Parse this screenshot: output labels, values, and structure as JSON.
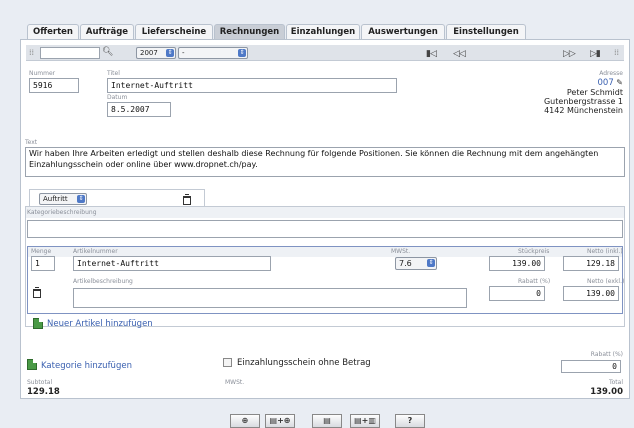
{
  "tabs": [
    {
      "label": "Offerten",
      "active": false
    },
    {
      "label": "Aufträge",
      "active": false
    },
    {
      "label": "Lieferscheine",
      "active": false
    },
    {
      "label": "Rechnungen",
      "active": true
    },
    {
      "label": "Einzahlungen",
      "active": false
    },
    {
      "label": "Auswertungen",
      "active": false
    },
    {
      "label": "Einstellungen",
      "active": false
    }
  ],
  "nav": {
    "year": "2007",
    "filter": "-",
    "first": "▮◁",
    "prev": "◁◁",
    "next": "▷▷",
    "last": "▷▮"
  },
  "invoice": {
    "number_label": "Nummer",
    "number": "5916",
    "title_label": "Titel",
    "title": "Internet-Auftritt",
    "date_label": "Datum",
    "date": "8.5.2007",
    "address_label": "Adresse",
    "address_link": "007",
    "address_lines": [
      "Peter Schmidt",
      "Gutenbergstrasse 1",
      "4142 Münchenstein"
    ],
    "text_label": "Text",
    "text": "Wir haben Ihre Arbeiten erledigt und stellen deshalb diese Rechnung für folgende Positionen. Sie können die Rechnung mit dem angehängten Einzahlungsschein oder online über www.dropnet.ch/pay."
  },
  "category": {
    "type_select": "Auftritt",
    "description_label": "Kategoriebeschreibung",
    "description": ""
  },
  "article": {
    "qty_label": "Menge",
    "qty": "1",
    "number_label": "Artikelnummer",
    "number": "Internet-Auftritt",
    "vat_label": "MWSt.",
    "vat": "7.6",
    "unit_price_label": "Stückpreis",
    "unit_price": "139.00",
    "net_label": "Netto (inkl.)",
    "net": "129.18",
    "desc_label": "Artikelbeschreibung",
    "desc": "",
    "discount_label": "Rabatt (%)",
    "discount": "0",
    "net2_label": "Netto (exkl.)",
    "net2": "139.00"
  },
  "add_article": "Neuer Artikel hinzufügen",
  "add_category": "Kategorie hinzufügen",
  "einzahlung_checkbox": "Einzahlungsschein ohne Betrag",
  "totals": {
    "rabatt_label": "Rabatt (%)",
    "rabatt": "0",
    "subtotal_label": "Subtotal",
    "subtotal": "129.18",
    "mwst_label": "MWSt.",
    "total_label": "Total",
    "total": "139.00"
  },
  "buttons": [
    "⊕",
    "▤+⊕",
    "▤",
    "▤+▥",
    "?"
  ]
}
